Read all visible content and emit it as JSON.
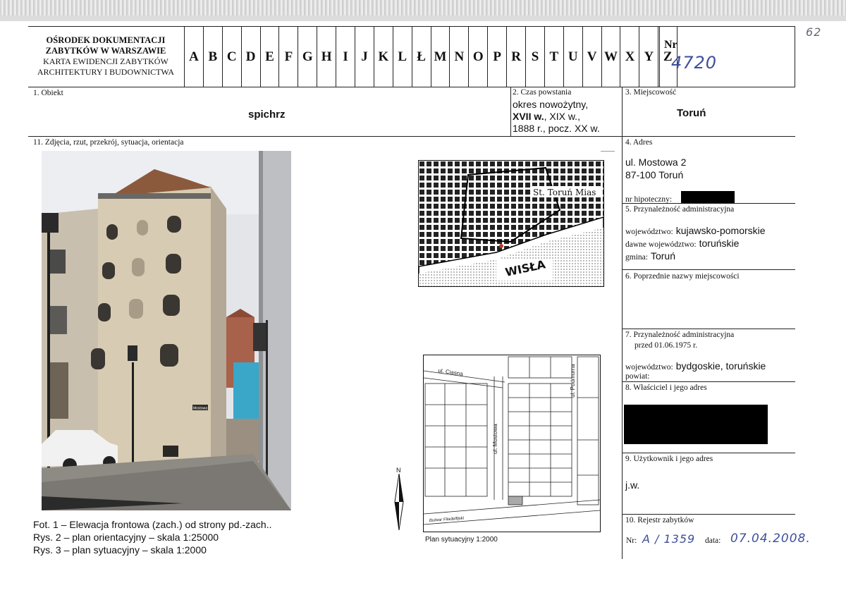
{
  "corner_note": "62",
  "header": {
    "org_line1": "OŚRODEK DOKUMENTACJI",
    "org_line2": "ZABYTKÓW W WARSZAWIE",
    "org_line3": "KARTA EWIDENCJI ZABYTKÓW",
    "org_line4": "ARCHITEKTURY I BUDOWNICTWA",
    "letters": [
      "A",
      "B",
      "C",
      "D",
      "E",
      "F",
      "G",
      "H",
      "I",
      "J",
      "K",
      "L",
      "Ł",
      "M",
      "N",
      "O",
      "P",
      "R",
      "S",
      "T",
      "U",
      "V",
      "W",
      "X",
      "Y",
      "Z"
    ],
    "nr_label": "Nr",
    "nr_value": "4720"
  },
  "fields": {
    "obiekt_label": "1. Obiekt",
    "obiekt_value": "spichrz",
    "czas_label": "2. Czas powstania",
    "czas_line1": "okres nowożytny,",
    "czas_line2_bold": "XVII w.",
    "czas_line2_rest": ", XIX w.,",
    "czas_line3": "1888 r.,  pocz. XX w.",
    "miejscowosc_label": "3. Miejscowość",
    "miejscowosc_value": "Toruń",
    "adres_label": "4. Adres",
    "adres_line1": "ul. Mostowa 2",
    "adres_line2": "87-100 Toruń",
    "hipoteczny_label": "nr hipoteczny:",
    "przynaleznosc_label": "5. Przynależność administracyjna",
    "wojewodztwo_label": "województwo:",
    "wojewodztwo_value": "kujawsko-pomorskie",
    "dawne_label": "dawne województwo:",
    "dawne_value": "toruńskie",
    "gmina_label": "gmina:",
    "gmina_value": "Toruń",
    "poprzednie_label": "6. Poprzednie nazwy miejscowości",
    "przyn1975_label_line1": "7. Przynależność administracyjna",
    "przyn1975_label_line2": "przed  01.06.1975 r.",
    "woj1975_label": "województwo:",
    "woj1975_value": "bydgoskie, toruńskie",
    "powiat_label": "powiat:",
    "wlasciciel_label": "8. Właściciel i jego adres",
    "uzytkownik_label": "9. Użytkownik i jego adres",
    "uzytkownik_value": "j.w.",
    "rejestr_label": "10. Rejestr zabytków",
    "rejestr_nr_label": "Nr:",
    "rejestr_nr_value": "A / 1359",
    "rejestr_data_label": "data:",
    "rejestr_data_value": "07.04.2008.",
    "zdjecia_label": "11. Zdjęcia, rzut, przekrój, sytuacja, orientacja"
  },
  "maps": {
    "map1_wisla": "WISŁA",
    "map1_miasto": "St. Toruń Mias",
    "map2_caption": "Plan sytuacyjny 1:2000",
    "map2_street1": "ul. Ciasna",
    "map2_street2": "ul. Mostowa",
    "map2_street3": "ul. Podmurna",
    "map2_street4": "Bulwar Filadelfijski",
    "north": "N"
  },
  "captions": {
    "line1": "Fot. 1 – Elewacja frontowa (zach.) od strony pd.-zach..",
    "line2": "Rys. 2 – plan orientacyjny – skala 1:25000",
    "line3": "Rys. 3 – plan sytuacyjny – skala 1:2000"
  },
  "photo": {
    "street_sign": "Mostowa"
  }
}
